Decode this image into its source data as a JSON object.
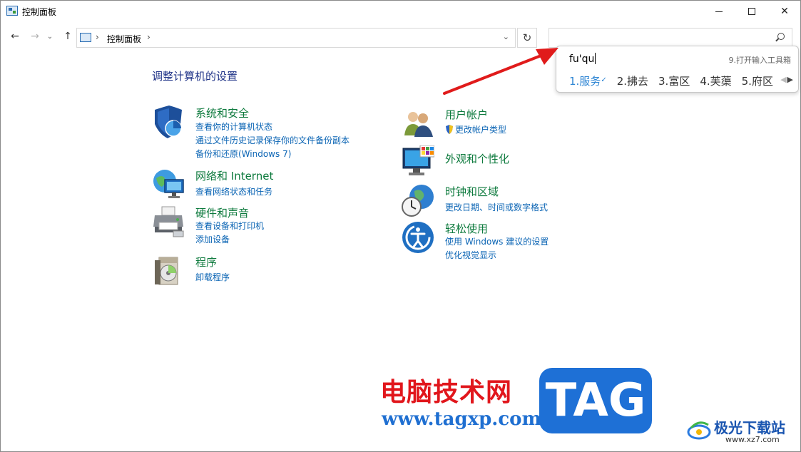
{
  "window": {
    "title": "控制面板"
  },
  "nav": {
    "back_icon": "arrow-left-icon",
    "forward_icon": "arrow-right-icon",
    "up_icon": "arrow-up-icon",
    "address_path": "控制面板",
    "refresh_icon": "refresh-icon"
  },
  "search": {
    "value": "",
    "icon": "search-icon"
  },
  "ime": {
    "composition": "fu'qu",
    "hint": "9.打开输入工具箱",
    "candidates": [
      "1.服务",
      "2.拂去",
      "3.富区",
      "4.芙蕖",
      "5.府区"
    ]
  },
  "main": {
    "heading": "调整计算机的设置",
    "categories": [
      {
        "title": "系统和安全",
        "icon": "security-shield-icon",
        "links": [
          "查看你的计算机状态",
          "通过文件历史记录保存你的文件备份副本",
          "备份和还原(Windows 7)"
        ]
      },
      {
        "title": "网络和 Internet",
        "icon": "network-globe-icon",
        "links": [
          "查看网络状态和任务"
        ]
      },
      {
        "title": "硬件和声音",
        "icon": "printer-icon",
        "links": [
          "查看设备和打印机",
          "添加设备"
        ]
      },
      {
        "title": "程序",
        "icon": "programs-disc-icon",
        "links": [
          "卸载程序"
        ]
      },
      {
        "title": "用户帐户",
        "icon": "user-accounts-icon",
        "links": [
          "更改帐户类型"
        ]
      },
      {
        "title": "外观和个性化",
        "icon": "monitor-icon",
        "links": []
      },
      {
        "title": "时钟和区域",
        "icon": "clock-globe-icon",
        "links": [
          "更改日期、时间或数字格式"
        ]
      },
      {
        "title": "轻松使用",
        "icon": "ease-of-access-icon",
        "links": [
          "使用 Windows 建议的设置",
          "优化视觉显示"
        ]
      }
    ]
  },
  "watermark": {
    "cn_text": "电脑技术网",
    "url": "www.tagxp.com",
    "tag": "TAG",
    "site_cn": "极光下载站",
    "site_url": "www.xz7.com"
  },
  "colors": {
    "link": "#0a64b4",
    "category": "#0d7a3d",
    "heading": "#1e3287",
    "arrow": "#e01b1b"
  }
}
